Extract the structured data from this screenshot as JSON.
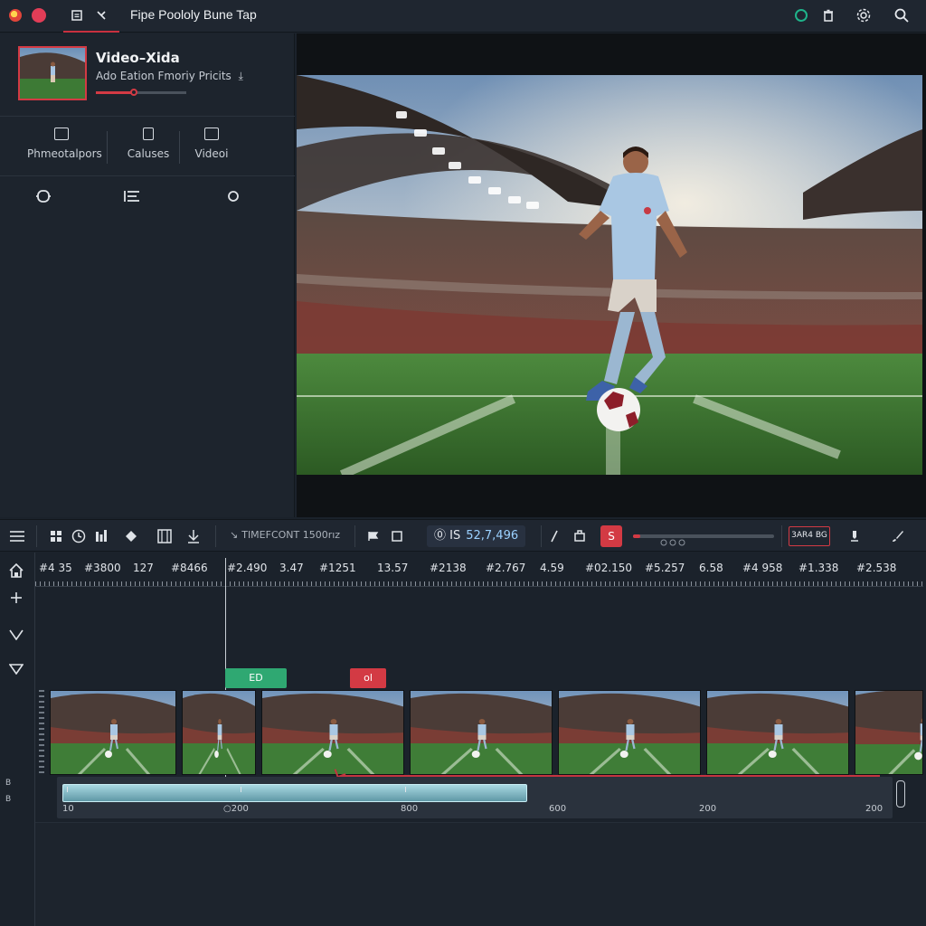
{
  "app": {
    "title": "Fipe Poololy Bune Tap",
    "tab_icons": [
      "clipboard-icon",
      "scissors-icon"
    ]
  },
  "topbar": {
    "icons": [
      "status-ring-icon",
      "trash-icon",
      "settings-gear-icon",
      "search-icon"
    ]
  },
  "media": {
    "title": "Video–Xida",
    "subtitle": "Ado Eation Fmoriy Pricits",
    "progress": 0.42
  },
  "categories": [
    {
      "label": "Phmeotalpors",
      "icon": "layers-icon"
    },
    {
      "label": "Caluses",
      "icon": "card-icon"
    },
    {
      "label": "Videoi",
      "icon": "video-icon"
    }
  ],
  "tools": [
    "loop-icon",
    "list-icon",
    "circle-icon"
  ],
  "toolbar": {
    "timecode_label": "TIMEFCONT 1500rız",
    "timecode_prefix": "⓪ IS",
    "timecode_value": "52,7,496",
    "rec_label": "S",
    "volume": 0.05,
    "mode_badge": "3AR4 BG",
    "icons": [
      "menu-icon",
      "grid-icon",
      "clock-icon",
      "bars-icon",
      "diamond-icon",
      "film-icon",
      "download-icon",
      "flag-icon",
      "square-icon",
      "pen-icon",
      "crop-icon",
      "marker-icon",
      "brush-icon"
    ]
  },
  "ruler": {
    "labels": [
      "#4 35",
      "#3800",
      "127",
      "#8466",
      "#2.490",
      "3.47",
      "#1251",
      "13.57",
      "#2138",
      "#2.767",
      "4.59",
      "#02.150",
      "#5.257",
      "6.58",
      "#4 958",
      "#1.338",
      "#2.538"
    ]
  },
  "markers": {
    "green": "ED",
    "red": "ol"
  },
  "track2": {
    "labels": [
      "10",
      "○200",
      "800",
      "600",
      "200",
      "200"
    ]
  },
  "timeline_side": [
    "home-icon",
    "add-icon",
    "chevron-down-icon",
    "triangle-down-icon"
  ]
}
